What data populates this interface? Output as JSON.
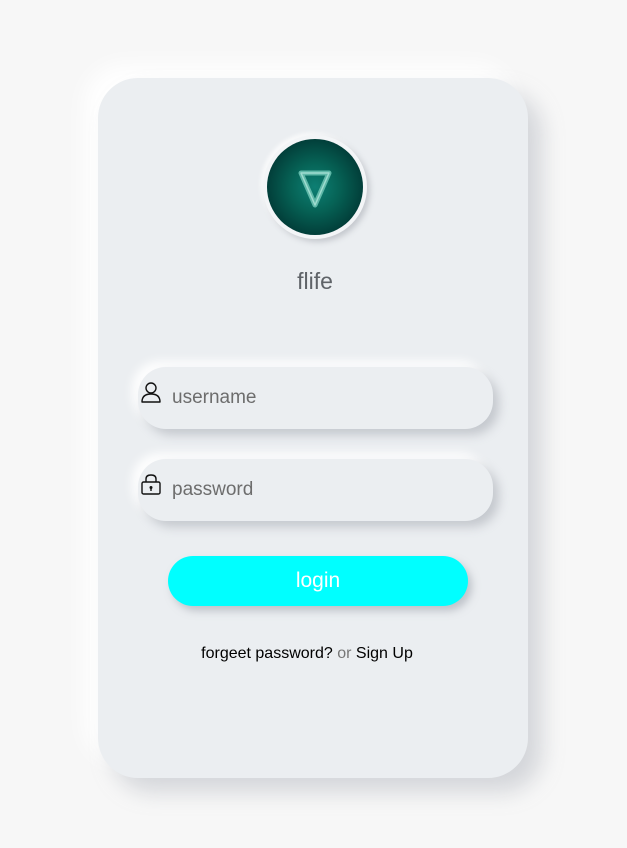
{
  "app": {
    "name": "flife",
    "logo_icon": "triangle-logo-icon"
  },
  "form": {
    "username": {
      "placeholder": "username",
      "value": "",
      "icon": "user-icon"
    },
    "password": {
      "placeholder": "password",
      "value": "",
      "icon": "lock-icon"
    },
    "login_label": "login"
  },
  "footer": {
    "forgot_label": "forgeet password?",
    "or_label": "or",
    "signup_label": "Sign Up"
  },
  "colors": {
    "background": "#f7f7f7",
    "card": "#ebeef1",
    "accent": "#00ffff",
    "logo_teal": "#066356"
  }
}
